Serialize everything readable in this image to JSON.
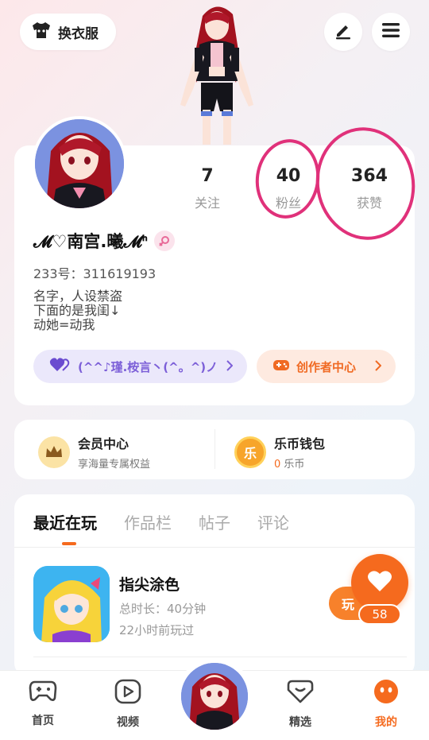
{
  "top_bar": {
    "dress_up_label": "换衣服",
    "edit_icon": "pencil-icon",
    "menu_icon": "hamburger-icon"
  },
  "profile": {
    "stats": [
      {
        "count": "7",
        "label": "关注"
      },
      {
        "count": "40",
        "label": "粉丝"
      },
      {
        "count": "364",
        "label": "获赞"
      }
    ],
    "nickname": "𝓜♡南宫.曦𝓜ᑋ",
    "uid_label": "233号：",
    "uid_value": "311619193",
    "bio_lines": [
      "名字，人设禁盗",
      "下面的是我闺↓",
      "动她=动我"
    ],
    "club_label": "(^^♪瑾.桉言丶(^。^)ノ",
    "creator_label": "创作者中心"
  },
  "membership": {
    "vip_title": "会员中心",
    "vip_subtitle": "享海量专属权益",
    "wallet_title": "乐币钱包",
    "wallet_badge": "乐",
    "wallet_amount": "0",
    "wallet_unit": " 乐币"
  },
  "tabs": [
    "最近在玩",
    "作品栏",
    "帖子",
    "评论"
  ],
  "recent_game": {
    "title": "指尖涂色",
    "duration": "总时长：40分钟",
    "last_played": "22小时前玩过",
    "play_label": "玩"
  },
  "like_count": "58",
  "bottom_nav": [
    {
      "label": "首页",
      "icon": "gamepad-icon"
    },
    {
      "label": "视频",
      "icon": "video-play-icon"
    },
    {
      "label": "精选",
      "icon": "heart-box-icon"
    },
    {
      "label": "我的",
      "icon": "face-icon"
    }
  ],
  "colors": {
    "accent": "#f56a1e",
    "purple": "#7c5fd8",
    "annotation": "#e0317a"
  }
}
